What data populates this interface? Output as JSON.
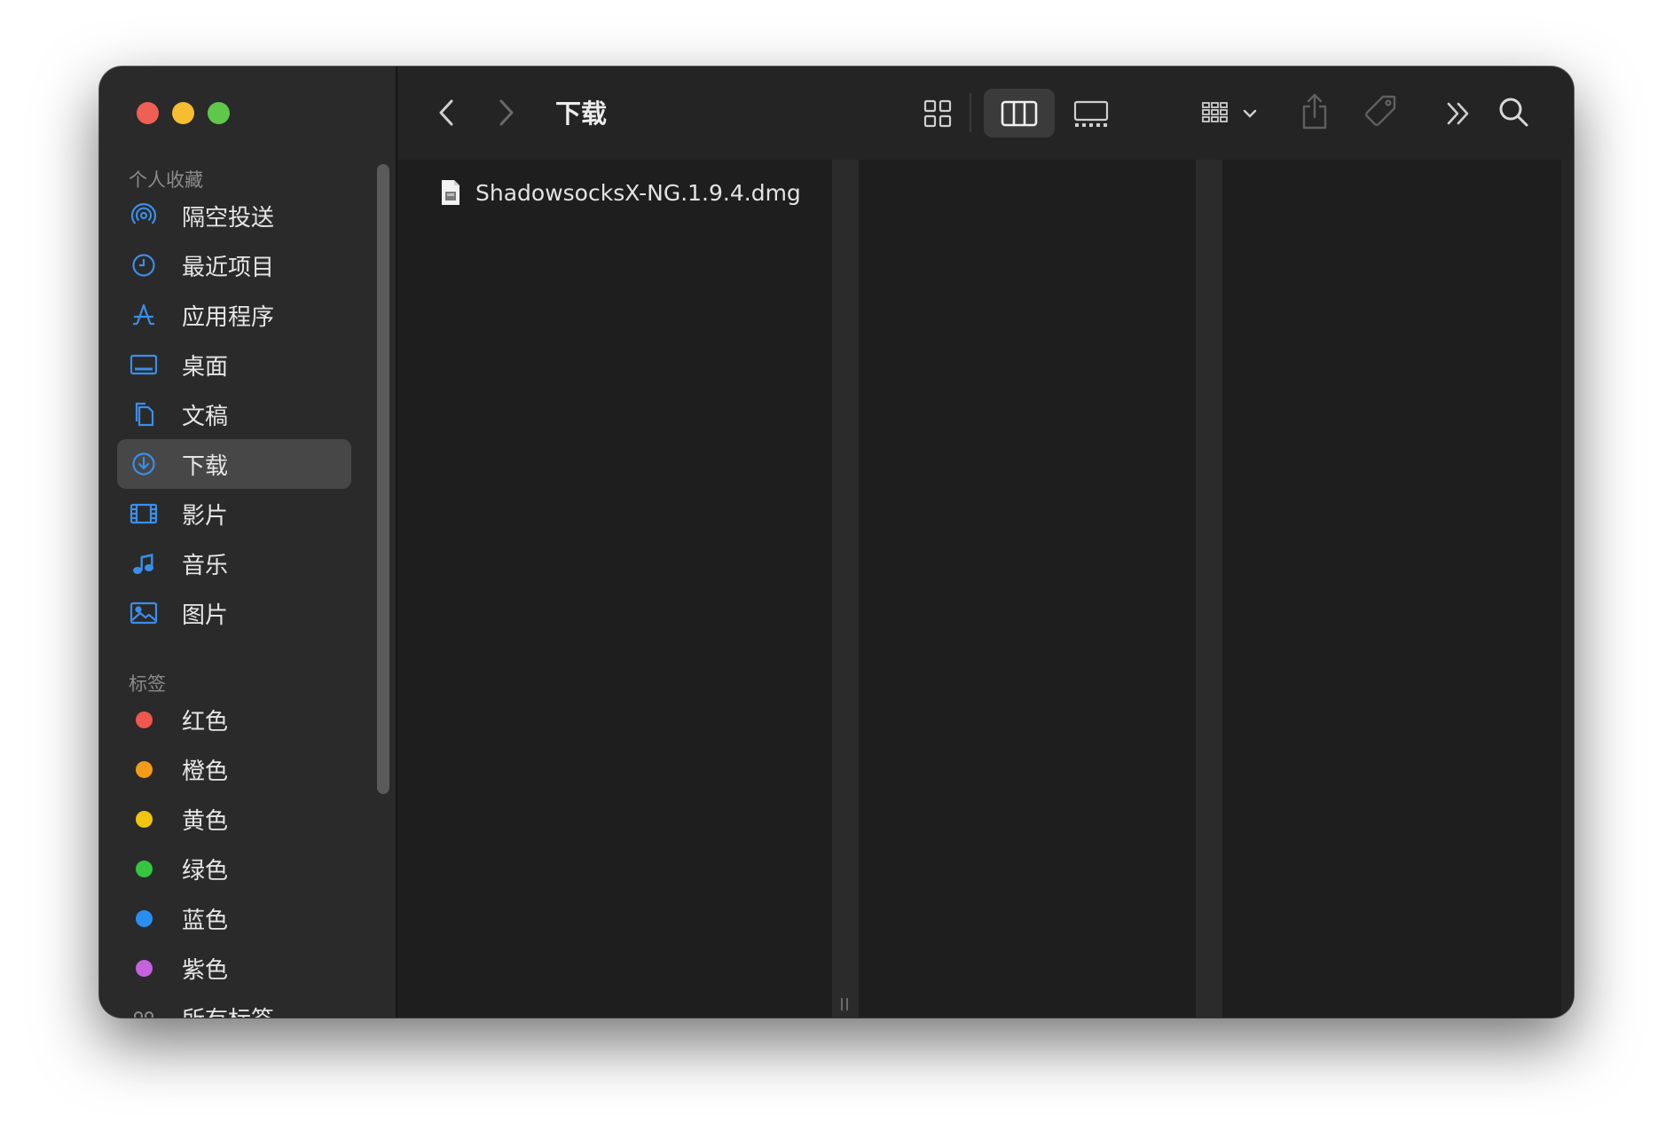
{
  "window": {
    "traffic_colors": [
      "#ee5f56",
      "#f6bd31",
      "#5fc84a"
    ]
  },
  "sidebar": {
    "favorites_title": "个人收藏",
    "favorites": [
      {
        "label": "隔空投送",
        "icon": "airdrop-icon"
      },
      {
        "label": "最近项目",
        "icon": "clock-icon"
      },
      {
        "label": "应用程序",
        "icon": "apps-icon"
      },
      {
        "label": "桌面",
        "icon": "desktop-icon"
      },
      {
        "label": "文稿",
        "icon": "document-icon"
      },
      {
        "label": "下载",
        "icon": "download-icon",
        "selected": true
      },
      {
        "label": "影片",
        "icon": "film-icon"
      },
      {
        "label": "音乐",
        "icon": "music-icon"
      },
      {
        "label": "图片",
        "icon": "photo-icon"
      }
    ],
    "tags_title": "标签",
    "tags": [
      {
        "label": "红色",
        "color": "#f1564f"
      },
      {
        "label": "橙色",
        "color": "#f49b1a"
      },
      {
        "label": "黄色",
        "color": "#f2c50f"
      },
      {
        "label": "绿色",
        "color": "#35c640"
      },
      {
        "label": "蓝色",
        "color": "#2a8ef0"
      },
      {
        "label": "紫色",
        "color": "#c463dd"
      }
    ],
    "all_tags_label": "所有标签…",
    "accent_color": "#3b8eea"
  },
  "toolbar": {
    "title": "下载",
    "view_mode": "columns"
  },
  "files": [
    {
      "name": "ShadowsocksX-NG.1.9.4.dmg",
      "icon": "disk-image-icon"
    }
  ]
}
